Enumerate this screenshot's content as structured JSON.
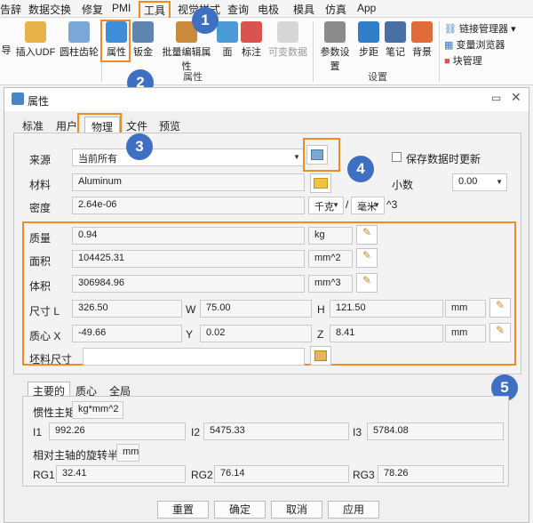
{
  "menubar": {
    "items": [
      "告辞",
      "数据交换",
      "修复",
      "PMI",
      "工具",
      "视觉样式",
      "查询",
      "电极",
      "模具",
      "仿真",
      "App"
    ]
  },
  "ribbon": {
    "buttons": {
      "import": "导",
      "insert_udf": "插入UDF",
      "cylinder_gear": "圆柱齿轮",
      "properties": "属性",
      "sheet_metal": "钣金",
      "batch_edit_properties": "批量编辑属性",
      "face": "面",
      "annotate": "标注",
      "variable_data": "可变数据",
      "param_settings": "参数设置",
      "step": "步距",
      "notes": "笔记",
      "background": "背景"
    },
    "right_items": [
      "链接管理器",
      "变量浏览器",
      "块管理"
    ],
    "group_labels": {
      "properties": "属性",
      "settings": "设置"
    }
  },
  "badges": [
    "1",
    "2",
    "3",
    "4",
    "5"
  ],
  "dialog": {
    "title": "属性",
    "tabs": [
      "标准",
      "用户",
      "物理",
      "文件",
      "预览"
    ],
    "source_label": "来源",
    "source_value": "当前所有",
    "save_on_update_label": "保存数据时更新",
    "material_label": "材料",
    "material_value": "Aluminum",
    "decimal_label": "小数",
    "decimal_value": "0.00",
    "density_label": "密度",
    "density_value": "2.64e-06",
    "density_unit_mass": "千克",
    "density_unit_length": "毫米",
    "density_unit_suffix": "^3",
    "mass_label": "质量",
    "mass_value": "0.94",
    "mass_unit": "kg",
    "area_label": "面积",
    "area_value": "104425.31",
    "area_unit": "mm^2",
    "volume_label": "体积",
    "volume_value": "306984.96",
    "volume_unit": "mm^3",
    "size_label": "尺寸 L",
    "size_l": "326.50",
    "size_w_label": "W",
    "size_w": "75.00",
    "size_h_label": "H",
    "size_h": "121.50",
    "size_unit": "mm",
    "centroid_label": "质心 X",
    "centroid_x": "-49.66",
    "centroid_y_label": "Y",
    "centroid_y": "0.02",
    "centroid_z_label": "Z",
    "centroid_z": "8.41",
    "centroid_unit": "mm",
    "blank_size_label": "坯料尺寸",
    "blank_size_value": "",
    "sub_tabs": [
      "主要的",
      "质心",
      "全局"
    ],
    "inertia_label": "惯性主矩",
    "inertia_unit": "kg*mm^2",
    "i1_label": "I1",
    "i1": "992.26",
    "i2_label": "I2",
    "i2": "5475.33",
    "i3_label": "I3",
    "i3": "5784.08",
    "gyration_label": "相对主轴的旋转半径",
    "gyration_unit": "mm",
    "rg1_label": "RG1",
    "rg1": "32.41",
    "rg2_label": "RG2",
    "rg2": "76.14",
    "rg3_label": "RG3",
    "rg3": "78.26",
    "buttons": [
      "重置",
      "确定",
      "取消",
      "应用"
    ]
  },
  "colors": {
    "accent": "#f08a24",
    "badge": "#3f6fc3"
  }
}
